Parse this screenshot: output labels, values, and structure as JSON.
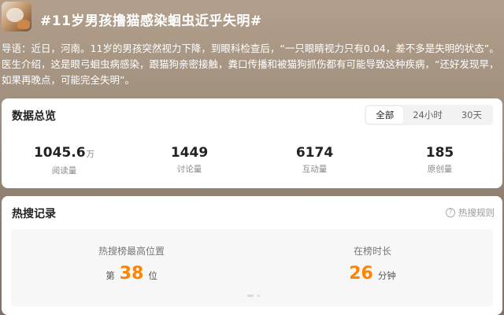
{
  "topic": {
    "title": "#11岁男孩撸猫感染蛔虫近乎失明#",
    "intro": "导语：近日，河南。11岁的男孩突然视力下降，到眼科检查后，“一只眼睛视力只有0.04，差不多是失明的状态”。医生介绍，这是眼弓蛔虫病感染，跟猫狗亲密接触，粪口传播和被猫狗抓伤都有可能导致这种疾病，“还好发现早，如果再晚点，可能完全失明”。"
  },
  "overview": {
    "title": "数据总览",
    "tabs": [
      {
        "label": "全部",
        "active": true
      },
      {
        "label": "24小时",
        "active": false
      },
      {
        "label": "30天",
        "active": false
      }
    ],
    "stats": [
      {
        "value": "1045.6",
        "unit": "万",
        "label": "阅读量"
      },
      {
        "value": "1449",
        "unit": "",
        "label": "讨论量"
      },
      {
        "value": "6174",
        "unit": "",
        "label": "互动量"
      },
      {
        "value": "185",
        "unit": "",
        "label": "原创量"
      }
    ]
  },
  "hot_search": {
    "title": "热搜记录",
    "rules_label": "热搜规则",
    "rules_icon": "help-circle-icon",
    "highest_position": {
      "label": "热搜榜最高位置",
      "prefix": "第",
      "value": "38",
      "suffix": "位"
    },
    "duration": {
      "label": "在榜时长",
      "value": "26",
      "suffix": "分钟"
    }
  },
  "colors": {
    "accent": "#ff8200",
    "header_bg": "#a08f7d"
  }
}
